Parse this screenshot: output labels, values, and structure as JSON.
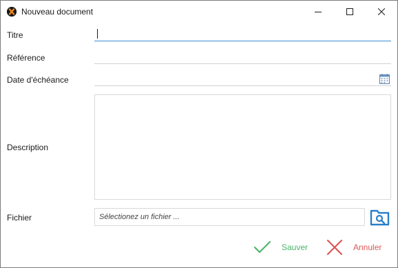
{
  "window": {
    "title": "Nouveau document"
  },
  "form": {
    "titre_label": "Titre",
    "titre_value": "",
    "reference_label": "Référence",
    "reference_value": "",
    "date_label": "Date d'échéance",
    "date_value": "",
    "description_label": "Description",
    "description_value": "",
    "fichier_label": "Fichier",
    "fichier_placeholder": "Sélectionez un fichier ..."
  },
  "actions": {
    "save_label": "Sauver",
    "cancel_label": "Annuler"
  },
  "colors": {
    "focus_underline": "#3d8ad6",
    "save": "#4cb56a",
    "cancel": "#e05555",
    "browse": "#2a7fc9"
  },
  "icons": {
    "app": "app-logo-icon",
    "minimize": "minimize-icon",
    "maximize": "maximize-icon",
    "close": "close-icon",
    "calendar": "calendar-icon",
    "browse": "folder-search-icon",
    "save": "checkmark-icon",
    "cancel": "cross-icon"
  }
}
